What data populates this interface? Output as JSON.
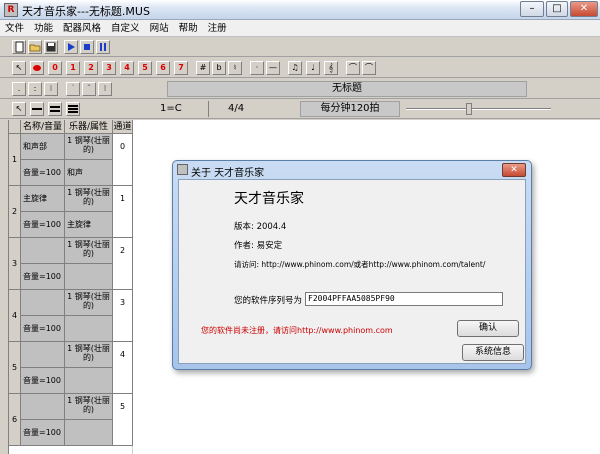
{
  "window": {
    "title": "天才音乐家---无标题.MUS",
    "app_icon": "R",
    "minimize": "–",
    "maximize": "□",
    "close": "✕"
  },
  "menu": [
    "文件",
    "功能",
    "配器风格",
    "自定义",
    "网站",
    "帮助",
    "注册"
  ],
  "toolbar1": {
    "icons": [
      "new-file-icon",
      "open-folder-icon",
      "save-disk-icon",
      "play-icon",
      "stop-icon",
      "pause-icon"
    ]
  },
  "toolbar2": {
    "note_numbers": [
      "0",
      "1",
      "2",
      "3",
      "4",
      "5",
      "6",
      "7"
    ],
    "symbols": [
      "#",
      "b",
      "♮",
      "·",
      "—",
      "♫",
      "♩",
      "𝄞",
      "⌒",
      "⌒"
    ]
  },
  "toolbar3": {
    "dots": [
      ".",
      ":",
      "⁝",
      "˙",
      "¨",
      "⁝"
    ],
    "score_title": "无标题"
  },
  "toolbar4": {
    "key": "1=C",
    "time_sig": "4/4",
    "tempo": "每分钟120拍"
  },
  "grid": {
    "headers": [
      "名称/音量",
      "乐器/属性",
      "通道"
    ],
    "tracks": [
      {
        "num": "1",
        "name": "和声部",
        "instrument": "1 钢琴(壮丽的)",
        "volume": "音量=100",
        "attr": "和声",
        "channel": "0"
      },
      {
        "num": "2",
        "name": "主旋律",
        "instrument": "1 钢琴(壮丽的)",
        "volume": "音量=100",
        "attr": "主旋律",
        "channel": "1"
      },
      {
        "num": "3",
        "name": "",
        "instrument": "1 钢琴(壮丽的)",
        "volume": "音量=100",
        "attr": "",
        "channel": "2"
      },
      {
        "num": "4",
        "name": "",
        "instrument": "1 钢琴(壮丽的)",
        "volume": "音量=100",
        "attr": "",
        "channel": "3"
      },
      {
        "num": "5",
        "name": "",
        "instrument": "1 钢琴(壮丽的)",
        "volume": "音量=100",
        "attr": "",
        "channel": "4"
      },
      {
        "num": "6",
        "name": "",
        "instrument": "1 钢琴(壮丽的)",
        "volume": "音量=100",
        "attr": "",
        "channel": "5"
      }
    ]
  },
  "dialog": {
    "title": "关于 天才音乐家",
    "close": "✕",
    "app_name": "天才音乐家",
    "version": "版本: 2004.4",
    "author": "作者: 易安定",
    "visit": "请访问: http://www.phinom.com/或者http://www.phinom.com/talent/",
    "serial_label": "您的软件序列号为",
    "serial": "F2004PFFAA5085PF90",
    "unregistered": "您的软件尚未注册，请访问http://www.phinom.com",
    "ok_button": "确认",
    "sysinfo_button": "系统信息"
  },
  "colors": {
    "accent_red": "#cc0000",
    "title_blue": "#a7c4ea",
    "play_blue": "#1a3fc8"
  }
}
